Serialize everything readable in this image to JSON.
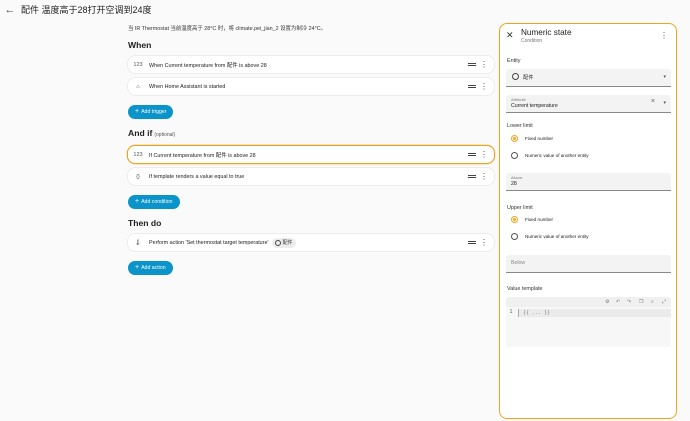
{
  "header": {
    "back_icon": "arrow-left-icon",
    "title": "配件 温度高于28打开空调到24度"
  },
  "main": {
    "description": "当 IR Thermostat 当前温度高于 28°C 时，将 climate.pei_jian_2 设置为制冷 24°C。",
    "when": {
      "heading": "When",
      "items": [
        {
          "icon": "123",
          "text": "When Current temperature from 配件 is above 28"
        },
        {
          "icon": "⌂",
          "text": "When Home Assistant is started"
        }
      ],
      "add_label": "Add trigger"
    },
    "and_if": {
      "heading": "And if",
      "optional": "(optional)",
      "items": [
        {
          "icon": "123",
          "text": "If Current temperature from 配件 is above 28"
        },
        {
          "icon": "{}",
          "text": "If template renders a value equal to true"
        }
      ],
      "add_label": "Add condition"
    },
    "then_do": {
      "heading": "Then do",
      "items": [
        {
          "icon": "🌡",
          "text": "Perform action 'Set thermostat target temperature'",
          "chip": "配件"
        }
      ],
      "add_label": "Add action"
    }
  },
  "panel": {
    "title": "Numeric state",
    "subtitle": "Condition",
    "entity_label": "Entity",
    "entity_value": "配件",
    "attribute_label": "Attribute",
    "attribute_value": "Current temperature",
    "lower_label": "Lower limit",
    "lower_options": [
      "Fixed number",
      "Numeric value of another entity"
    ],
    "lower_selected": 0,
    "above_label": "Above",
    "above_value": "28",
    "upper_label": "Upper limit",
    "upper_options": [
      "Fixed number",
      "Numeric value of another entity"
    ],
    "upper_selected": 0,
    "below_placeholder": "Below",
    "value_template_label": "Value template",
    "editor_line_number": "1",
    "editor_placeholder": "{{ ... }}"
  },
  "colors": {
    "accent": "#f0a31f",
    "button": "#0a94c9"
  }
}
